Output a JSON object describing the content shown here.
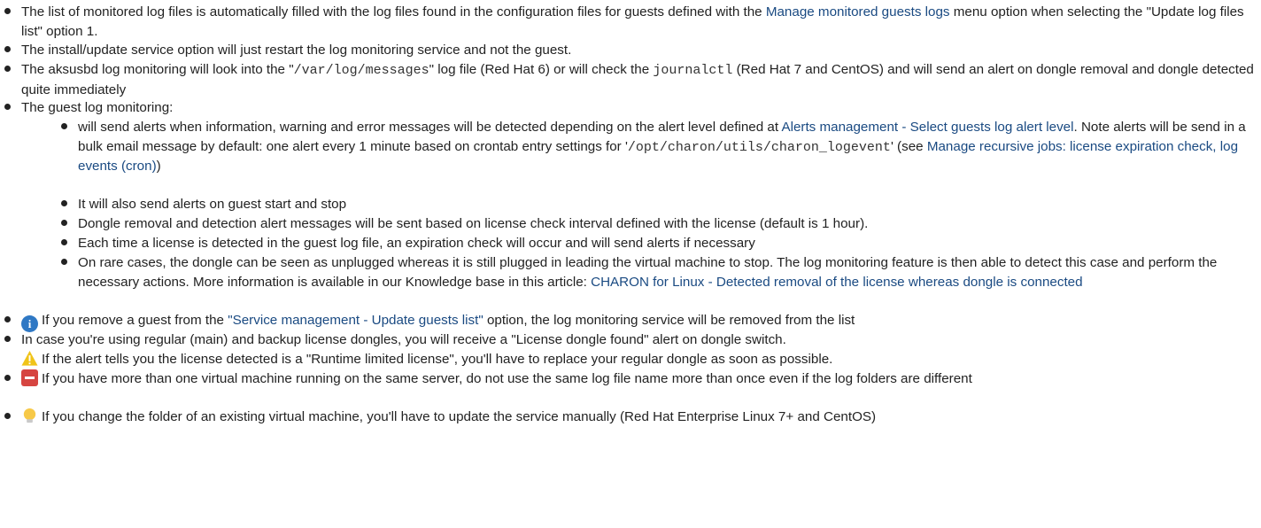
{
  "items": [
    {
      "t1": "The list of monitored log files is automatically filled with the log files found in the configuration files for guests defined with the ",
      "link": "Manage monitored guests logs",
      "t2": " menu option when selecting the \"Update log files list\" option 1."
    },
    {
      "text": "The install/update service option will just restart the log monitoring service and not the guest."
    },
    {
      "t1": "The aksusbd log monitoring will look into the \"",
      "code1": "/var/log/messages",
      "t2": "\" log file (Red Hat 6) or will check the ",
      "code2": "journalctl",
      "t3": " (Red Hat 7 and CentOS) and will send an alert on dongle removal and dongle detected quite immediately"
    },
    {
      "text": "The guest log monitoring:"
    }
  ],
  "sub": [
    {
      "t1": "will send alerts when information, warning and error messages will be detected depending on the alert level defined at ",
      "link1": "Alerts management - Select guests log alert level",
      "t2": ". Note alerts will be send in a bulk email message by default: one alert every 1 minute based on crontab entry settings for '",
      "code": "/opt/charon/utils/charon_logevent",
      "t3": "' (see ",
      "link2": "Manage recursive jobs: license expiration check, log events (cron)",
      "t4": ")"
    },
    {
      "text": "It will also send alerts on guest start and stop"
    },
    {
      "text": "Dongle removal and detection alert messages will be sent based on license check interval defined with the license (default is 1 hour)."
    },
    {
      "text": "Each time a license is detected in the guest log file, an expiration check will occur and will send alerts if necessary"
    },
    {
      "t1": "On rare cases, the dongle can be seen as unplugged whereas it is still plugged in leading the virtual machine to stop. The log monitoring feature is then able to detect this case and perform the necessary actions. More information is available in our Knowledge base in this article: ",
      "link": "CHARON for Linux - Detected removal of the license whereas dongle is connected"
    }
  ],
  "items2": [
    {
      "icon": "info-icon",
      "t1": "If you remove a guest from the ",
      "link": "\"Service management - Update guests list\"",
      "t2": " option, the log monitoring service will be removed from the list"
    },
    {
      "text": "In case you're using regular (main) and backup license dongles, you will receive a \"License dongle found\" alert on dongle switch."
    },
    {
      "icon": "warning-icon",
      "text": "If the alert tells you the license detected is a \"Runtime limited license\", you'll have to replace your regular dongle as soon as possible."
    },
    {
      "icon": "remove-icon",
      "text": "If you have more than one virtual machine running on the same server, do not use the same log file name more than once even if the log folders are different"
    },
    {
      "icon": "lightbulb-icon",
      "text": "If you change the folder of an existing virtual machine, you'll have to update the service manually (Red Hat Enterprise Linux 7+ and CentOS)"
    }
  ],
  "colors": {
    "text": "#222222",
    "link": "#1a4a82",
    "info": "#2f78c4",
    "warning": "#f0c419",
    "remove": "#d64541",
    "bulb": "#f7c948"
  }
}
